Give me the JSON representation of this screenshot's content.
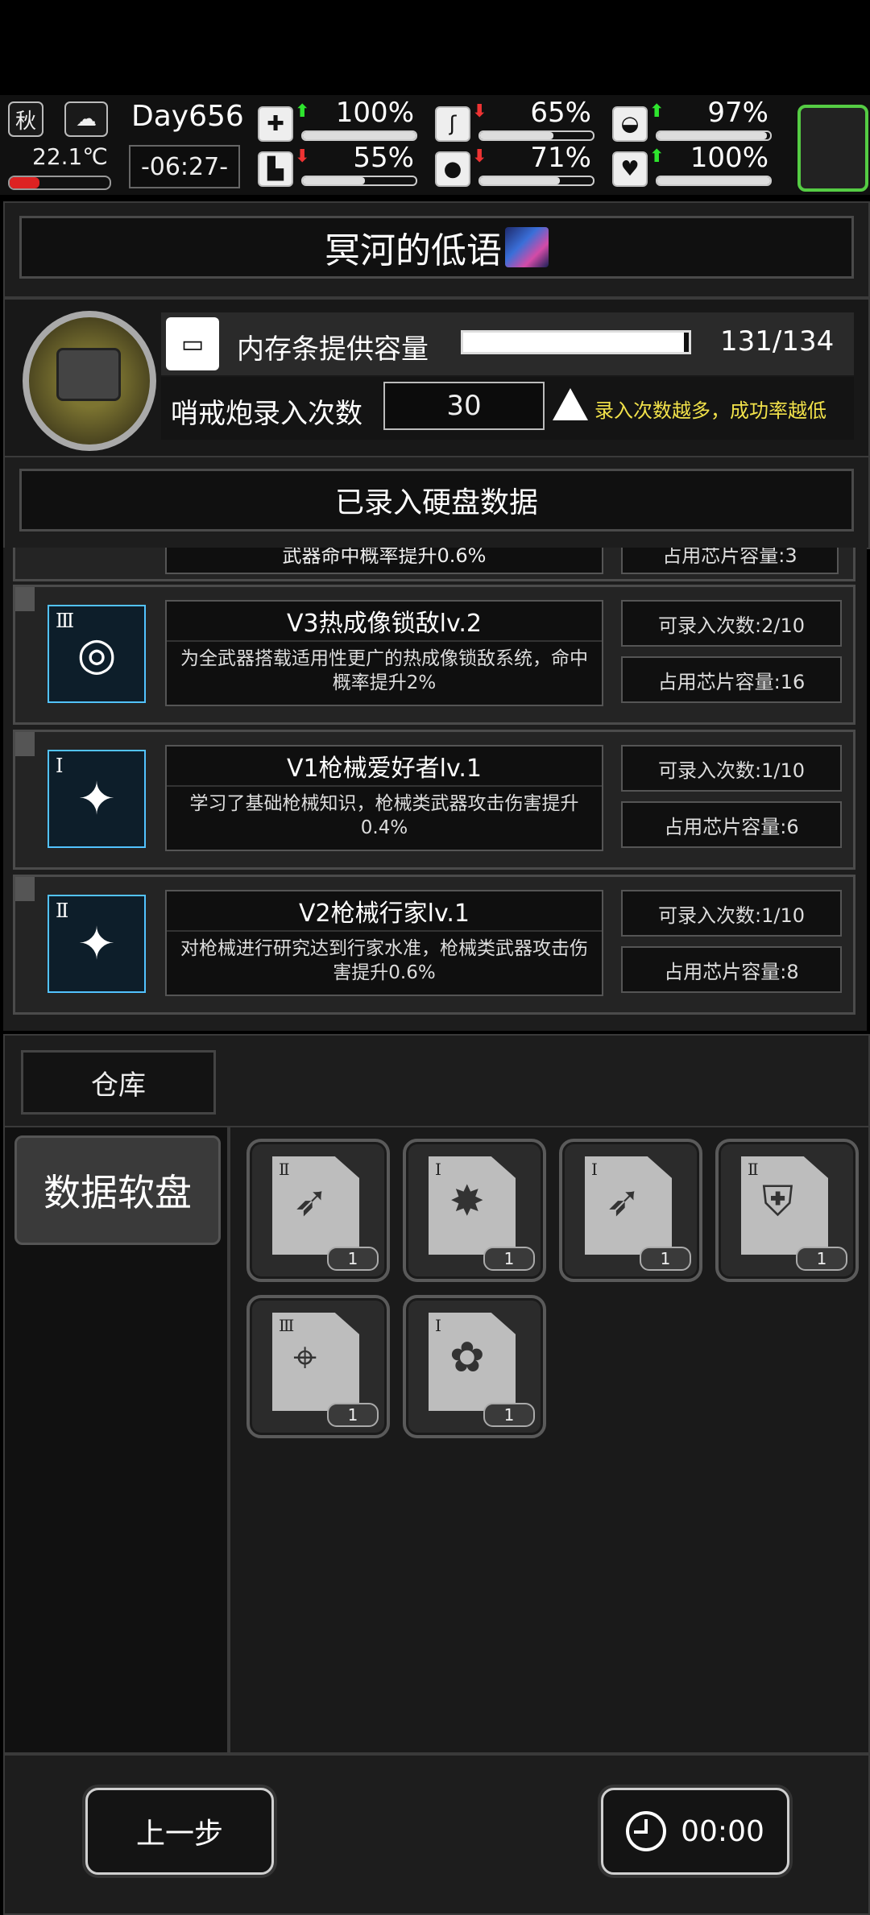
{
  "status": {
    "season": "秋",
    "temperature": "22.1℃",
    "day": "Day656",
    "time": "-06:27-",
    "stats": [
      {
        "key": "health",
        "icon": "medkit-icon",
        "value": "100%",
        "fill": 1.0,
        "trend": "up"
      },
      {
        "key": "hunger",
        "icon": "stomach-icon",
        "value": "65%",
        "fill": 0.65,
        "trend": "down"
      },
      {
        "key": "mood",
        "icon": "helmet-icon",
        "value": "97%",
        "fill": 0.97,
        "trend": "up"
      },
      {
        "key": "stamina",
        "icon": "boot-icon",
        "value": "55%",
        "fill": 0.55,
        "trend": "down"
      },
      {
        "key": "water",
        "icon": "water-drop-icon",
        "value": "71%",
        "fill": 0.71,
        "trend": "down"
      },
      {
        "key": "heart",
        "icon": "heart-icon",
        "value": "100%",
        "fill": 1.0,
        "trend": "up"
      }
    ]
  },
  "title": {
    "text": "冥河的低语"
  },
  "turret": {
    "memory_label": "内存条提供容量",
    "memory_value": "131/134",
    "memory_fill": 0.978,
    "record_label": "哨戒炮录入次数",
    "record_value": "30",
    "warning": "录入次数越多，成功率越低"
  },
  "recorded": {
    "header": "已录入硬盘数据",
    "partial": {
      "desc": "武器命中概率提升0.6%",
      "capacity": "占用芯片容量:3"
    },
    "cards": [
      {
        "tier": "Ⅲ",
        "icon": "crosshair-target-icon",
        "name": "V3热成像锁敌lv.2",
        "desc": "为全武器搭载适用性更广的热成像锁敌系统，命中概率提升2%",
        "times": "可录入次数:2/10",
        "capacity": "占用芯片容量:16"
      },
      {
        "tier": "Ⅰ",
        "icon": "gun-upgrade-icon",
        "name": "V1枪械爱好者lv.1",
        "desc": "学习了基础枪械知识，枪械类武器攻击伤害提升0.4%",
        "times": "可录入次数:1/10",
        "capacity": "占用芯片容量:6"
      },
      {
        "tier": "Ⅱ",
        "icon": "gun-upgrade-icon",
        "name": "V2枪械行家lv.1",
        "desc": "对枪械进行研究达到行家水准，枪械类武器攻击伤害提升0.6%",
        "times": "可录入次数:1/10",
        "capacity": "占用芯片容量:8"
      }
    ]
  },
  "warehouse": {
    "tab": "仓库",
    "category": "数据软盘",
    "items": [
      {
        "tier": "Ⅱ",
        "icon": "bow-upgrade-icon",
        "count": "1"
      },
      {
        "tier": "Ⅰ",
        "icon": "gun-damage-icon",
        "count": "1"
      },
      {
        "tier": "Ⅰ",
        "icon": "bow-upgrade-icon",
        "count": "1"
      },
      {
        "tier": "Ⅱ",
        "icon": "gun-shield-icon",
        "count": "1"
      },
      {
        "tier": "Ⅲ",
        "icon": "bow-crosshair-icon",
        "count": "1"
      },
      {
        "tier": "Ⅰ",
        "icon": "maple-leaf-icon",
        "count": "1"
      }
    ]
  },
  "footer": {
    "back": "上一步",
    "timer": "00:00"
  }
}
